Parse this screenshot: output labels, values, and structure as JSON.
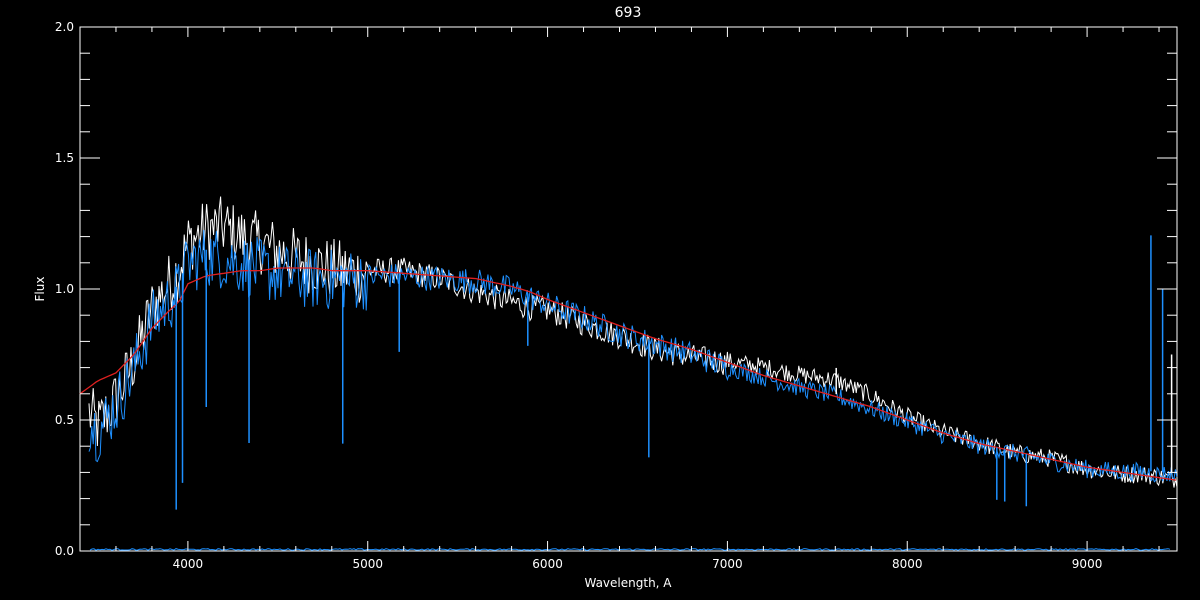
{
  "chart_data": {
    "type": "line",
    "title": "693",
    "xlabel": "Wavelength, A",
    "ylabel": "Flux",
    "xlim": [
      3400,
      9500
    ],
    "ylim": [
      0.0,
      2.0
    ],
    "xticks": [
      4000,
      5000,
      6000,
      7000,
      8000,
      9000
    ],
    "xtick_labels": [
      "4000",
      "5000",
      "6000",
      "7000",
      "8000",
      "9000"
    ],
    "yticks": [
      0.0,
      0.5,
      1.0,
      1.5,
      2.0
    ],
    "ytick_labels": [
      "0.0",
      "0.5",
      "1.0",
      "1.5",
      "2.0"
    ],
    "grid": false,
    "colors": {
      "background": "#000000",
      "axes": "#ffffff",
      "white_series": "#ffffff",
      "blue_series": "#1e90ff",
      "red_series": "#e02020"
    },
    "series": [
      {
        "style": "white-noisy",
        "x": [
          3450,
          3500,
          3600,
          3700,
          3800,
          3900,
          3950,
          4000,
          4100,
          4200,
          4300,
          4400,
          4500,
          4600,
          4700,
          4800,
          4900,
          5000,
          5200,
          5400,
          5600,
          5800,
          5900,
          6000,
          6200,
          6400,
          6600,
          6800,
          7000,
          7200,
          7400,
          7600,
          7800,
          8000,
          8200,
          8400,
          8600,
          8800,
          9000,
          9200,
          9300,
          9400,
          9500
        ],
        "y": [
          0.55,
          0.5,
          0.6,
          0.75,
          0.95,
          1.05,
          1.1,
          1.2,
          1.25,
          1.26,
          1.22,
          1.2,
          1.17,
          1.14,
          1.12,
          1.1,
          1.09,
          1.08,
          1.08,
          1.05,
          1.0,
          0.96,
          0.94,
          0.93,
          0.88,
          0.83,
          0.78,
          0.75,
          0.73,
          0.71,
          0.68,
          0.66,
          0.6,
          0.52,
          0.46,
          0.42,
          0.38,
          0.36,
          0.32,
          0.3,
          0.3,
          0.29,
          0.28
        ]
      },
      {
        "style": "blue-noisy",
        "x": [
          3450,
          3500,
          3600,
          3700,
          3800,
          3900,
          3950,
          4000,
          4100,
          4200,
          4300,
          4400,
          4500,
          4600,
          4700,
          4800,
          4900,
          5000,
          5200,
          5400,
          5600,
          5800,
          5900,
          6000,
          6200,
          6400,
          6600,
          6800,
          7000,
          7200,
          7400,
          7600,
          7800,
          8000,
          8200,
          8400,
          8600,
          8800,
          9000,
          9200,
          9300,
          9400,
          9500
        ],
        "y": [
          0.52,
          0.48,
          0.58,
          0.72,
          0.9,
          0.98,
          1.02,
          1.12,
          1.15,
          1.14,
          1.12,
          1.1,
          1.08,
          1.07,
          1.06,
          1.06,
          1.06,
          1.06,
          1.06,
          1.05,
          1.04,
          1.01,
          0.98,
          0.95,
          0.9,
          0.84,
          0.8,
          0.76,
          0.71,
          0.67,
          0.63,
          0.6,
          0.55,
          0.5,
          0.45,
          0.41,
          0.38,
          0.35,
          0.32,
          0.31,
          0.31,
          0.3,
          0.3
        ]
      },
      {
        "style": "red-model",
        "x": [
          3400,
          3500,
          3600,
          3700,
          3800,
          3900,
          3950,
          4000,
          4100,
          4200,
          4300,
          4400,
          4500,
          4600,
          4700,
          4800,
          4900,
          5000,
          5200,
          5400,
          5600,
          5800,
          5900,
          6000,
          6200,
          6400,
          6600,
          6800,
          7000,
          7200,
          7400,
          7600,
          7800,
          8000,
          8200,
          8400,
          8600,
          8800,
          9000,
          9200,
          9300,
          9400,
          9500
        ],
        "y": [
          0.6,
          0.65,
          0.68,
          0.75,
          0.85,
          0.92,
          0.95,
          1.02,
          1.05,
          1.06,
          1.07,
          1.07,
          1.08,
          1.08,
          1.08,
          1.07,
          1.07,
          1.07,
          1.06,
          1.05,
          1.04,
          1.01,
          0.99,
          0.96,
          0.91,
          0.86,
          0.81,
          0.77,
          0.72,
          0.67,
          0.63,
          0.59,
          0.55,
          0.5,
          0.45,
          0.41,
          0.38,
          0.35,
          0.32,
          0.3,
          0.29,
          0.28,
          0.27
        ]
      }
    ],
    "absorption_lines": [
      {
        "x": 3935,
        "depth": 0.85,
        "color": "blue"
      },
      {
        "x": 3970,
        "depth": 0.8,
        "color": "blue"
      },
      {
        "x": 4102,
        "depth": 0.6,
        "color": "blue"
      },
      {
        "x": 4340,
        "depth": 0.7,
        "color": "blue"
      },
      {
        "x": 4861,
        "depth": 0.65,
        "color": "blue"
      },
      {
        "x": 5175,
        "depth": 0.3,
        "color": "blue"
      },
      {
        "x": 5890,
        "depth": 0.2,
        "color": "blue"
      },
      {
        "x": 6563,
        "depth": 0.45,
        "color": "blue"
      },
      {
        "x": 8498,
        "depth": 0.2,
        "color": "blue"
      },
      {
        "x": 8542,
        "depth": 0.2,
        "color": "blue"
      },
      {
        "x": 8662,
        "depth": 0.2,
        "color": "blue"
      }
    ],
    "emission_spikes": [
      {
        "x": 7605,
        "height": 0.1,
        "color": "white"
      },
      {
        "x": 9355,
        "height": 0.9,
        "color": "blue"
      },
      {
        "x": 9420,
        "height": 0.7,
        "color": "blue"
      },
      {
        "x": 9470,
        "height": 0.45,
        "color": "white"
      }
    ]
  }
}
